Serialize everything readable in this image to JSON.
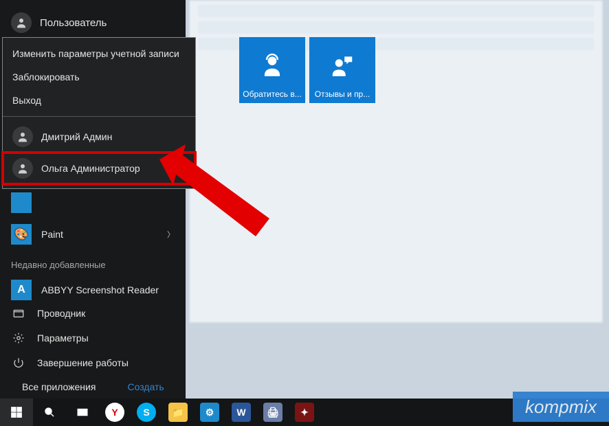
{
  "user": {
    "name": "Пользователь"
  },
  "flyout": {
    "change_account": "Изменить параметры учетной записи",
    "lock": "Заблокировать",
    "signout": "Выход",
    "users": [
      {
        "name": "Дмитрий Админ"
      },
      {
        "name": "Ольга Администратор"
      }
    ]
  },
  "apps": {
    "paint": "Paint",
    "recent_label": "Недавно добавленные",
    "abbyy": "ABBYY Screenshot Reader"
  },
  "bottom": {
    "explorer": "Проводник",
    "settings": "Параметры",
    "power": "Завершение работы",
    "allapps": "Все приложения",
    "create": "Создать"
  },
  "tiles": {
    "support": "Обратитесь в...",
    "feedback": "Отзывы и пр..."
  },
  "watermark": "kompmix",
  "colors": {
    "tile": "#0f7ad1",
    "highlight": "#d40000"
  }
}
